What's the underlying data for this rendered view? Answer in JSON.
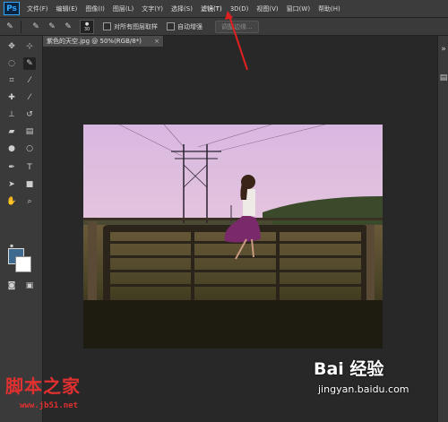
{
  "menubar": {
    "logo": "Ps",
    "items": [
      "文件(F)",
      "编辑(E)",
      "图像(I)",
      "图层(L)",
      "文字(Y)",
      "选择(S)",
      "滤镜(T)",
      "3D(D)",
      "视图(V)",
      "窗口(W)",
      "帮助(H)"
    ],
    "active_index": 6
  },
  "options": {
    "brush_size": "30",
    "sample_all_layers": "对所有图层取样",
    "auto_enhance": "自动增强",
    "refine_edge": "调整边缘..."
  },
  "document": {
    "tab_title": "紫色的天空.jpg @ 50%(RGB/8*)",
    "close": "×"
  },
  "colors": {
    "foreground": "#3d6a8e",
    "background": "#ffffff",
    "annotation_arrow": "#e02020",
    "watermark": "#e03030"
  },
  "watermarks": {
    "site_name": "脚本之家",
    "site_url": "www.jb51.net",
    "baidu_label": "Bai  经验",
    "baidu_url": "jingyan.baidu.com"
  }
}
